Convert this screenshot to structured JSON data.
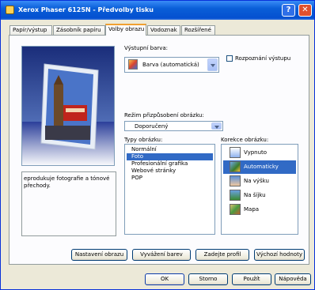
{
  "window": {
    "title": "Xerox Phaser 6125N - Předvolby tisku",
    "help": "?",
    "close": "✕"
  },
  "tabs": [
    "Papír/výstup",
    "Zásobník papíru",
    "Volby obrazu",
    "Vodoznak",
    "Rozšířené"
  ],
  "active_tab": "Volby obrazu",
  "output_color": {
    "label": "Výstupní barva:",
    "value": "Barva (automatická)"
  },
  "output_recognition": {
    "label": "Rozpoznání výstupu",
    "checked": false
  },
  "adjust_mode": {
    "label": "Režim přizpůsobení obrázku:",
    "value": "Doporučený"
  },
  "image_types": {
    "label": "Typy obrázku:",
    "items": [
      "Normální",
      "Foto",
      "Profesionální grafika",
      "Webové stránky",
      "POP"
    ],
    "selected": "Foto"
  },
  "image_correction": {
    "label": "Korekce obrázku:",
    "items": [
      {
        "label": "Vypnuto",
        "icon": "correction-off-icon"
      },
      {
        "label": "Automaticky",
        "icon": "auto-correction-icon"
      },
      {
        "label": "Na výšku",
        "icon": "portrait-icon"
      },
      {
        "label": "Na šíjku",
        "icon": "landscape-icon"
      },
      {
        "label": "Mapa",
        "icon": "map-icon"
      }
    ],
    "selected": "Automaticky"
  },
  "description": "eprodukuje fotografie a tónové přechody.",
  "panel_buttons": [
    "Nastavení obrazu",
    "Vyvážení barev",
    "Zadejte profil",
    "Výchozí hodnoty"
  ],
  "dialog_buttons": [
    "OK",
    "Storno",
    "Použít",
    "Nápověda"
  ],
  "colors": {
    "title_bar": "#0a5fd8",
    "selection": "#316ac5",
    "dialog_bg": "#ece9d8"
  }
}
